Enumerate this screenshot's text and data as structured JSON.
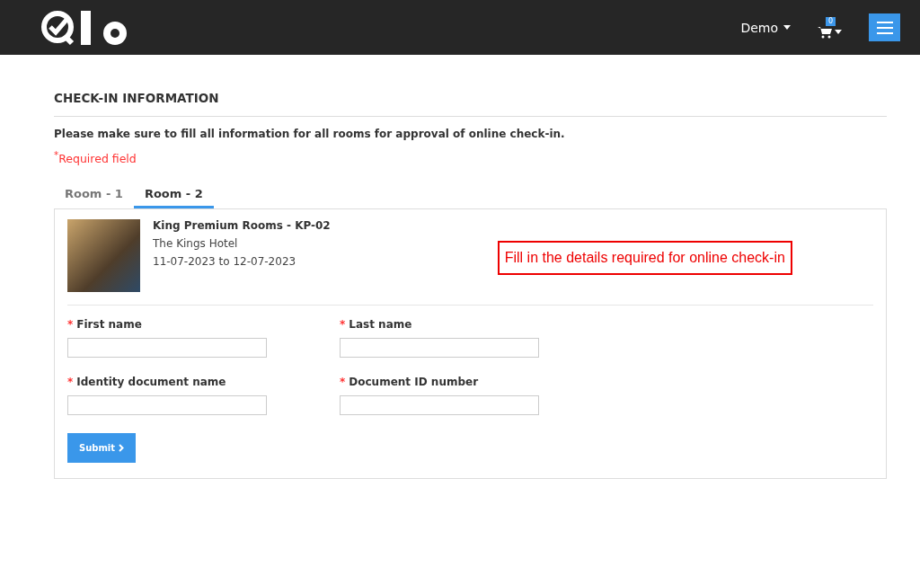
{
  "navbar": {
    "user_menu": "Demo",
    "cart_count": "0"
  },
  "page": {
    "title": "CHECK-IN INFORMATION",
    "instruction": "Please make sure to fill all information for all rooms for approval of online check-in.",
    "required_note": "$^{*}$Required field"
  },
  "tabs": [
    {
      "label": "Room - 1",
      "selected": false
    },
    {
      "label": "Room - 2",
      "selected": true
    }
  ],
  "room": {
    "name": "King Premium Rooms - KP-02",
    "hotel": "The Kings Hotel",
    "dates": "11-07-2023 to 12-07-2023"
  },
  "callout": "Fill in the details required for online check-in",
  "fields": [
    {
      "mark": "*",
      "label": "First name"
    },
    {
      "mark": "*",
      "label": "Last name"
    },
    {
      "mark": "*",
      "label": "Identity document name"
    },
    {
      "mark": "*",
      "label": "Document ID number"
    }
  ],
  "submit": "Submit"
}
